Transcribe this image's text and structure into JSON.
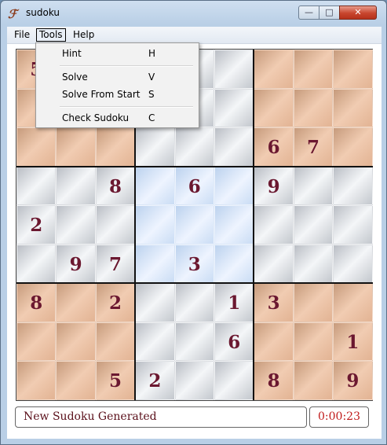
{
  "window": {
    "title": "sudoku",
    "icon": "app-icon",
    "buttons": [
      "minimize",
      "maximize",
      "close"
    ]
  },
  "menubar": {
    "items": [
      "File",
      "Tools",
      "Help"
    ],
    "open": "Tools"
  },
  "tools_menu": {
    "items": [
      {
        "label": "Hint",
        "shortcut": "H"
      },
      {
        "label": "Solve",
        "shortcut": "V"
      },
      {
        "label": "Solve From Start",
        "shortcut": "S"
      },
      {
        "label": "Check Sudoku",
        "shortcut": "C"
      }
    ]
  },
  "board": {
    "colors": {
      "orange": "#e8bb9c",
      "gray": "#d6d9de",
      "blue": "#d8e6fa",
      "digit": "#6b1830"
    },
    "box_styles": [
      [
        "o",
        "g",
        "o"
      ],
      [
        "g",
        "b",
        "g"
      ],
      [
        "o",
        "g",
        "o"
      ]
    ],
    "rows": [
      [
        "5",
        "",
        "",
        "",
        "",
        "",
        "",
        "",
        ""
      ],
      [
        "",
        "",
        "",
        "",
        "",
        "",
        "",
        "",
        ""
      ],
      [
        "",
        "",
        "",
        "",
        "",
        "",
        "6",
        "7",
        ""
      ],
      [
        "",
        "",
        "8",
        "",
        "6",
        "",
        "9",
        "",
        ""
      ],
      [
        "2",
        "",
        "",
        "",
        "",
        "",
        "",
        "",
        ""
      ],
      [
        "",
        "9",
        "7",
        "",
        "3",
        "",
        "",
        "",
        ""
      ],
      [
        "8",
        "",
        "2",
        "",
        "",
        "1",
        "3",
        "",
        ""
      ],
      [
        "",
        "",
        "",
        "",
        "",
        "6",
        "",
        "",
        "1"
      ],
      [
        "",
        "",
        "5",
        "2",
        "",
        "",
        "8",
        "",
        "9"
      ]
    ]
  },
  "status": {
    "message": "New Sudoku Generated",
    "timer": "0:00:23"
  }
}
